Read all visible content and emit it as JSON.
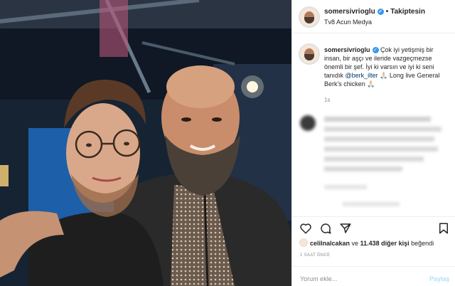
{
  "header": {
    "username": "somersivrioglu",
    "separator": "•",
    "follow_label": "Takiptesin",
    "location": "Tv8 Acun Medya"
  },
  "caption": {
    "username": "somersivrioglu",
    "text_before": " Çok iyi yetişmiş bir insan, bir aşçı ve ileride vazgeçmezse önemli bir şef. İyi ki varsın ve iyi ki seni tanıdık ",
    "mention": "@berk_ilter",
    "text_after": " 🙏🏻 Long live General Berk's chicken 🙏🏻",
    "time": "1s"
  },
  "likes": {
    "user": "celilnalcakan",
    "connector": " ve ",
    "count_text": "11.438 diğer kişi",
    "suffix": " beğendi"
  },
  "post_time": "1 SAAT ÖNCE",
  "comment": {
    "placeholder": "Yorum ekle...",
    "post_label": "Paylaş"
  },
  "icons": {
    "like": "heart-icon",
    "comment": "comment-icon",
    "share": "paper-plane-icon",
    "save": "bookmark-icon",
    "verified": "verified-badge-icon"
  },
  "colors": {
    "verified": "#3897f0",
    "mention": "#00376b",
    "muted": "#8e8e8e",
    "post_disabled": "#b2dffc"
  }
}
